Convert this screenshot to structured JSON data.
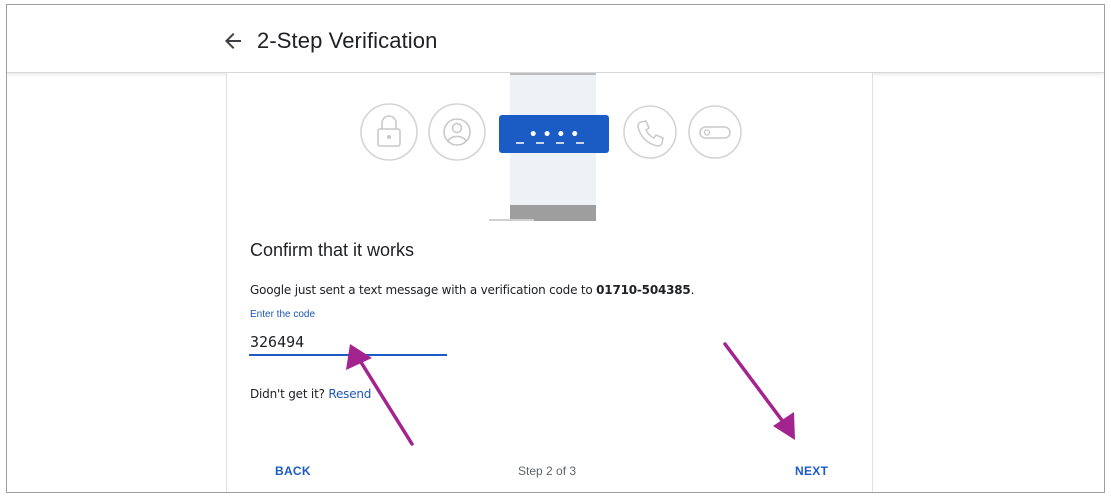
{
  "header": {
    "title": "2-Step Verification",
    "back_icon": "arrow-left-icon"
  },
  "illustration": {
    "icons": [
      "lock-icon",
      "account-circle-icon",
      "sms-code-icon",
      "phone-icon",
      "key-icon"
    ],
    "code_dots": "• • • •",
    "colors": {
      "accent": "#1a5bc4",
      "icon_stroke": "#d4d4d4",
      "phone_body": "#eef1f6",
      "phone_bar": "#bdbdbd"
    }
  },
  "content": {
    "title": "Confirm that it works",
    "description_prefix": "Google just sent a text message with a verification code to ",
    "phone_number": "01710-504385",
    "description_suffix": ".",
    "code_label": "Enter the code",
    "code_value": "326494",
    "resend_prompt": "Didn't get it? ",
    "resend_link": "Resend"
  },
  "footer": {
    "back_label": "BACK",
    "step_text": "Step 2 of 3",
    "next_label": "NEXT"
  },
  "annotations": {
    "arrow_color": "#a3248f",
    "arrows": [
      "arrow-to-code-field",
      "arrow-to-next-button"
    ]
  }
}
